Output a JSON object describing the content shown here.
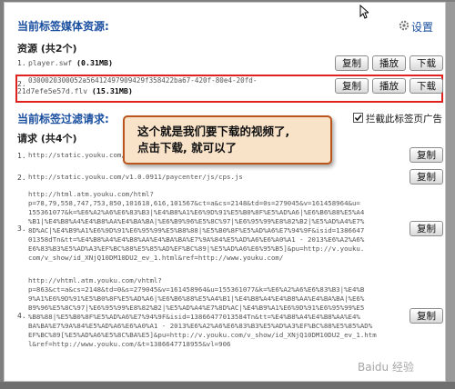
{
  "header": {
    "section1_title": "当前标签媒体资源:",
    "settings_label": "设置"
  },
  "resources": {
    "subtitle": "资源 (共2个)",
    "items": [
      {
        "num": "1.",
        "name": "player.swf",
        "size": "(0.31MB)",
        "copy": "复制",
        "play": "播放",
        "download": "下载"
      },
      {
        "num": "2.",
        "name_line1": "0300020300052a56412497909429f358422ba67-420f-80e4-20fd-",
        "name_line2": "21d7efe5e57d.flv",
        "size": "(15.31MB)",
        "copy": "复制",
        "play": "播放",
        "download": "下载"
      }
    ]
  },
  "filter": {
    "title": "当前标签过滤请求:",
    "checkbox_label": "拦截此标签页广告",
    "checkbox_checked": true,
    "requests_subtitle": "请求 (共4个)",
    "requests": [
      {
        "num": "1.",
        "lines": [
          "http://static.youku.com/v1.0.0911/..."
        ],
        "copy": "复制"
      },
      {
        "num": "2.",
        "lines": [
          "http://static.youku.com/v1.0.0911/paycenter/js/cps.js"
        ],
        "copy": "复制"
      },
      {
        "num": "3.",
        "lines": [
          "http://html.atm.youku.com/html?",
          "p=78,79,558,747,753,850,101618,616,101567&ct=a&cs=2148&td=0s=279045&v=161458964&u=",
          "155361077&k=%E6%A2%A6%E6%83%B3|%E4%B8%A1%E6%9D%91%E5%B0%8F%E5%AD%A6|%E6%B6%88%E5%A4",
          "%B1|%E4%B8%A4%E4%B8%AA%E4%BA%BA|%E6%B9%96%E5%8C%97|%E6%95%99%E8%82%B2|%E5%AD%A4%E7%",
          "8D%AC|%E4%B9%A1%E6%9D%91%E6%95%99%E5%B8%88|%E5%B0%8F%E5%AD%A6%E7%94%9F&isid=1386647",
          "01358dTn&tt=%E4%B8%A4%E4%B8%AA%E4%BA%BA%E7%9A%84%E5%AD%A6%E6%A0%A1 - 2013%E6%A2%A6%",
          "E6%83%B3%E5%AD%A3%EF%BC%88%E5%85%AD%EF%BC%89|%E5%AD%A6%E6%95%B5]&pu=http://v.youku.",
          "com/v_show/id_XNjQ10DM10DU2_ev_1.html&ref=http://www.youku.com/"
        ],
        "copy": "复制"
      },
      {
        "num": "4.",
        "lines": [
          "http://vhtml.atm.youku.com/vhtml?",
          "p=863&ct=a&cs=2148&td=0&s=279045&v=161458964&u=155361077&k=%E6%A2%A6%E6%83%B3|%E4%B",
          "9%A1%E6%9D%91%E5%B0%8F%E5%AD%A6|%E6%B6%88%E5%A4%B1|%E4%B8%A4%E4%B8%AA%E4%BA%BA|%E6%",
          "B9%96%E5%8C%97|%E6%95%99%E8%82%B2|%E5%AD%A4%E7%8D%AC|%E4%B9%A1%E6%9D%91%E6%95%99%E5",
          "%B8%88|%E5%B0%8F%E5%AD%A6%E7%94%9F&isid=13866477013584Tn&tt=%E4%B8%A4%E4%B8%AA%E4%",
          "BA%BA%E7%9A%84%E5%AD%A6%E6%A0%A1 - 2013%E6%A2%A6%E6%83%B3%E5%AD%A3%EF%BC%88%E5%85%AD%",
          "EF%BC%89[%E5%AD%A6%E5%8C%BA%E5]&pu=http://v.youku.com/v_show/id_XNjQ10DM10DU2_ev_1.htm",
          "l&ref=http://www.youku.com/&t=1386647718955&vl=906"
        ],
        "copy": "复制"
      }
    ]
  },
  "callout": {
    "line1": "这个就是我们要下载的视频了,",
    "line2": "点击下载, 就可以了"
  },
  "watermark": "Baidu 经验",
  "colors": {
    "title_blue": "#1a4fa0",
    "highlight_red": "#e0211e",
    "callout_bg": "#f8e3c9",
    "callout_border": "#b9551d"
  }
}
